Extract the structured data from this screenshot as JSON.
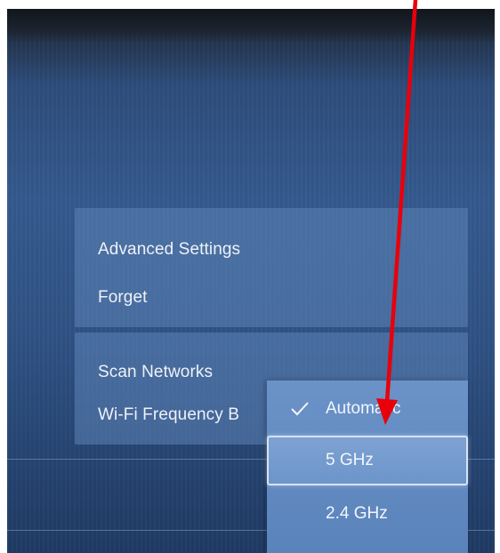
{
  "settings_menu": {
    "group1": [
      "Advanced Settings",
      "Forget"
    ],
    "group2": [
      "Scan Networks",
      "Wi-Fi Frequency B"
    ]
  },
  "frequency_dropdown": {
    "options": [
      {
        "label": "Automatic",
        "selected": true
      },
      {
        "label": "5 GHz",
        "selected": false
      },
      {
        "label": "2.4 GHz",
        "selected": false
      }
    ],
    "focused_option": "5 GHz",
    "check_icon": "checkmark-icon"
  },
  "annotation": {
    "type": "arrow",
    "color": "#e8000b",
    "points_to": "5 GHz"
  },
  "colors": {
    "background": "#2f5284",
    "panel": "#5c84b6",
    "dropdown": "#6b93c8",
    "text": "#eef2f8"
  }
}
